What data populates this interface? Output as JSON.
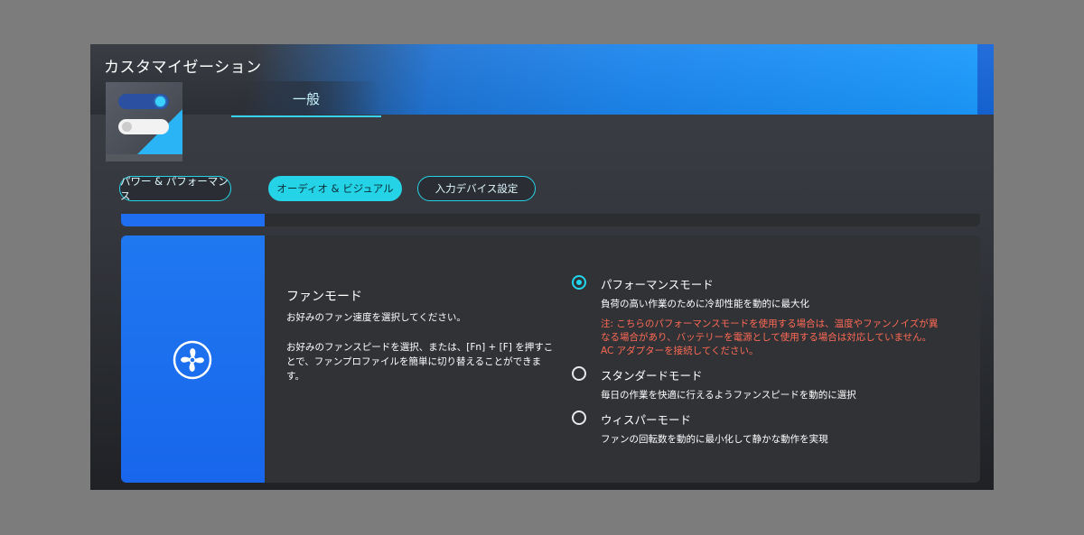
{
  "window": {
    "title": "カスタマイゼーション"
  },
  "tabs": {
    "general_label": "一般"
  },
  "categories": [
    {
      "label": "パワー & パフォーマンス",
      "active": false
    },
    {
      "label": "オーディオ & ビジュアル",
      "active": true
    },
    {
      "label": "入力デバイス設定",
      "active": false
    }
  ],
  "fan_mode": {
    "title": "ファンモード",
    "subtitle": "お好みのファン速度を選択してください。",
    "description": "お好みのファンスピードを選択、または、[Fn] + [F] を押すことで、ファンプロファイルを簡単に切り替えることができます。",
    "options": [
      {
        "label": "パフォーマンスモード",
        "description": "負荷の高い作業のために冷却性能を動的に最大化",
        "note": "注: こちらのパフォーマンスモードを使用する場合は、温度やファンノイズが異なる場合があり、バッテリーを電源として使用する場合は対応していません。AC アダプターを接続してください。",
        "selected": true
      },
      {
        "label": "スタンダードモード",
        "description": "毎日の作業を快適に行えるようファンスピードを動的に選択",
        "selected": false
      },
      {
        "label": "ウィスパーモード",
        "description": "ファンの回転数を動的に最小化して静かな動作を実現",
        "selected": false
      }
    ]
  },
  "colors": {
    "accent_cyan": "#25d3e6",
    "brand_blue": "#1f78f0",
    "warning_text": "#ff6a55"
  },
  "icons": {
    "header_illustration": "toggle-switches-icon",
    "fan": "fan-icon"
  }
}
